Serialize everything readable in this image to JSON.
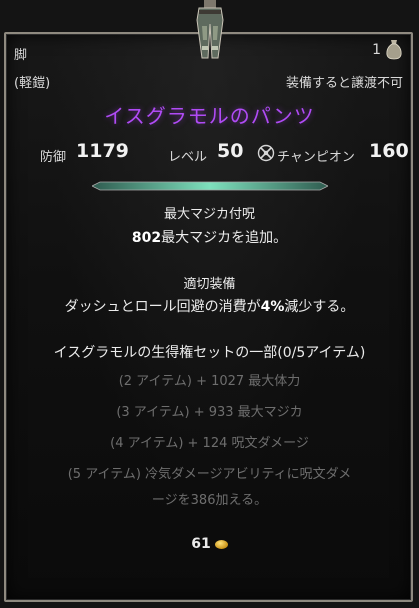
{
  "item": {
    "slot": "脚",
    "count": "1",
    "weight": "(軽鎧)",
    "bind": "装備すると譲渡不可",
    "name": "イスグラモルのパンツ"
  },
  "stats": {
    "armor_label": "防御",
    "armor_value": "1179",
    "level_label": "レベル",
    "level_value": "50",
    "champion_label": "チャンピオン",
    "champion_value": "160"
  },
  "enchant": {
    "title": "最大マジカ付呪",
    "line_prefix": "802",
    "line_rest": "最大マジカを追加。"
  },
  "trait": {
    "title": "適切装備",
    "line_a": "ダッシュとロール回避の消費が",
    "line_value": "4%",
    "line_b": "減少する。"
  },
  "set": {
    "title": "イスグラモルの生得権セットの一部(0/5アイテム)",
    "bonus1": "(2 アイテム) + 1027 最大体力",
    "bonus2": "(3 アイテム) + 933 最大マジカ",
    "bonus3": "(4 アイテム) + 124 呪文ダメージ",
    "bonus4_line1": "(5 アイテム) 冷気ダメージアビリティに呪文ダメ",
    "bonus4_line2": "ージを386加える。"
  },
  "value": {
    "gold": "61"
  },
  "colors": {
    "name_purple": "#b04bf5",
    "inactive_grey": "#6e6e6e",
    "divider_teal": "#4fb392"
  },
  "icons": {
    "item": "pants-icon",
    "bag": "bag-icon",
    "champion": "champion-point-icon",
    "gold": "gold-coin-icon"
  }
}
